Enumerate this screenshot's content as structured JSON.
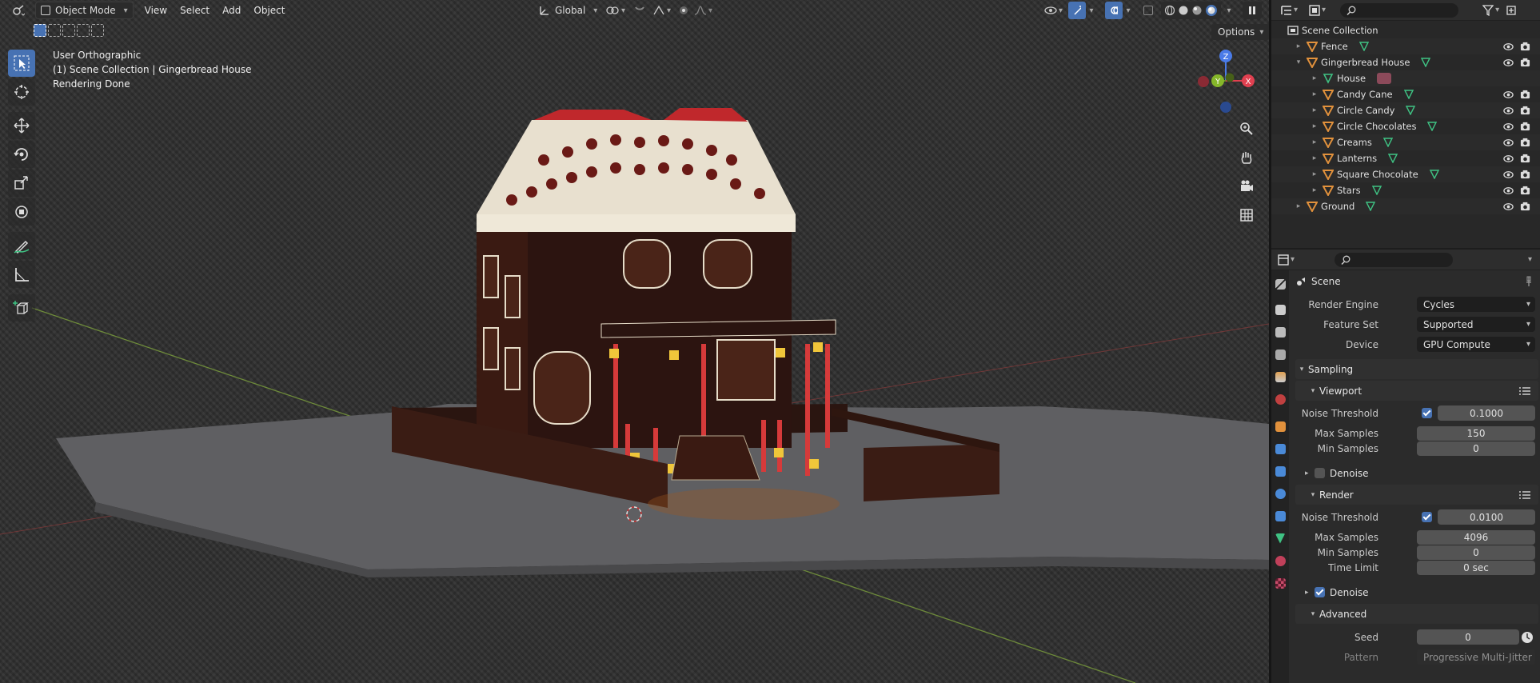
{
  "viewport_header": {
    "mode": "Object Mode",
    "menus": [
      "View",
      "Select",
      "Add",
      "Object"
    ],
    "transform_orientation": "Global",
    "options_label": "Options"
  },
  "viewport_overlay": {
    "line1": "User Orthographic",
    "line2": "(1) Scene Collection | Gingerbread House",
    "line3": "Rendering Done"
  },
  "gizmo": {
    "x": "X",
    "y": "Y",
    "z": "Z"
  },
  "outliner": {
    "search_placeholder": "",
    "root": "Scene Collection",
    "items": [
      {
        "label": "Fence",
        "level": 1,
        "expand": "▸"
      },
      {
        "label": "Gingerbread House",
        "level": 1,
        "expand": "▾"
      },
      {
        "label": "House",
        "level": 2,
        "expand": "▸"
      },
      {
        "label": "Candy Cane",
        "level": 2,
        "expand": "▸"
      },
      {
        "label": "Circle Candy",
        "level": 2,
        "expand": "▸"
      },
      {
        "label": "Circle Chocolates",
        "level": 2,
        "expand": "▸"
      },
      {
        "label": "Creams",
        "level": 2,
        "expand": "▸"
      },
      {
        "label": "Lanterns",
        "level": 2,
        "expand": "▸"
      },
      {
        "label": "Square Chocolate",
        "level": 2,
        "expand": "▸"
      },
      {
        "label": "Stars",
        "level": 2,
        "expand": "▸"
      },
      {
        "label": "Ground",
        "level": 1,
        "expand": "▸"
      }
    ]
  },
  "properties": {
    "context": "Scene",
    "render_engine_label": "Render Engine",
    "render_engine": "Cycles",
    "feature_set_label": "Feature Set",
    "feature_set": "Supported",
    "device_label": "Device",
    "device": "GPU Compute",
    "sampling": "Sampling",
    "viewport": "Viewport",
    "vp_noise_threshold_label": "Noise Threshold",
    "vp_noise_threshold": "0.1000",
    "vp_max_samples_label": "Max Samples",
    "vp_max_samples": "150",
    "vp_min_samples_label": "Min Samples",
    "vp_min_samples": "0",
    "vp_denoise": "Denoise",
    "render": "Render",
    "r_noise_threshold_label": "Noise Threshold",
    "r_noise_threshold": "0.0100",
    "r_max_samples_label": "Max Samples",
    "r_max_samples": "4096",
    "r_min_samples_label": "Min Samples",
    "r_min_samples": "0",
    "r_time_limit_label": "Time Limit",
    "r_time_limit": "0 sec",
    "r_denoise": "Denoise",
    "advanced": "Advanced",
    "seed_label": "Seed",
    "seed": "0",
    "pattern_label": "Pattern",
    "pattern": "Progressive Multi-Jitter"
  },
  "colors": {
    "accent": "#4772b3",
    "object_orange": "#e1913c",
    "mesh_green": "#3fc283"
  }
}
